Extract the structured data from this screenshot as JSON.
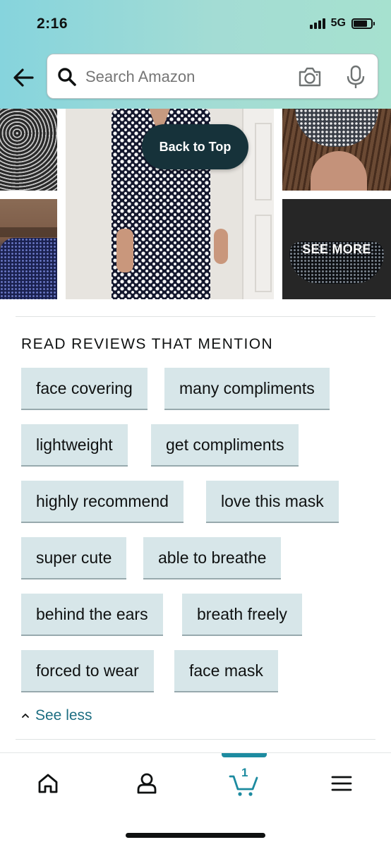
{
  "status_bar": {
    "time": "2:16",
    "network": "5G",
    "battery_level": 0.8
  },
  "header": {
    "search_placeholder": "Search Amazon",
    "icons": [
      "back-arrow-icon",
      "search-icon",
      "camera-icon",
      "microphone-icon"
    ]
  },
  "gallery": {
    "back_to_top_label": "Back to Top",
    "see_more_label": "SEE MORE"
  },
  "reviews": {
    "title": "READ REVIEWS THAT MENTION",
    "chips": [
      "face covering",
      "many compliments",
      "lightweight",
      "get compliments",
      "highly recommend",
      "love this mask",
      "super cute",
      "able to breathe",
      "behind the ears",
      "breath freely",
      "forced to wear",
      "face mask"
    ],
    "see_less_label": "See less"
  },
  "bottom_nav": {
    "cart_count": "1",
    "items": [
      "home-icon",
      "account-icon",
      "cart-icon",
      "menu-icon"
    ]
  },
  "colors": {
    "header_gradient_start": "#86d4dd",
    "header_gradient_end": "#a6e1cf",
    "chip_bg": "#d7e6e9",
    "link": "#1d6e82",
    "cart_accent": "#1d8ba0",
    "back_to_top_bg": "#16323a"
  }
}
